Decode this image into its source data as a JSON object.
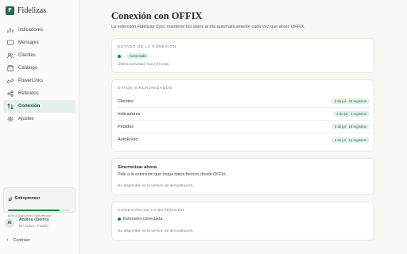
{
  "brand": {
    "name": "Fidelizas",
    "logo_letter": "F"
  },
  "nav": [
    {
      "label": "Indicadores",
      "icon": "chart-icon",
      "active": false
    },
    {
      "label": "Mensajes",
      "icon": "message-icon",
      "active": false
    },
    {
      "label": "Clientes",
      "icon": "users-icon",
      "active": false
    },
    {
      "label": "Catálogo",
      "icon": "box-icon",
      "active": false
    },
    {
      "label": "PowerLinks",
      "icon": "link-icon",
      "active": false
    },
    {
      "label": "Referidos",
      "icon": "share-icon",
      "active": false
    },
    {
      "label": "Conexión",
      "icon": "sync-icon",
      "active": true
    },
    {
      "label": "Ajustes",
      "icon": "gear-icon",
      "active": false
    }
  ],
  "plan": {
    "name": "Entrepreneur",
    "progress_fraction": 0.82,
    "note": "82% a Executive Entrepreneur"
  },
  "user": {
    "initials": "AI",
    "name": "Andrea (Demo)",
    "meta": "ID: Activo · Fusión"
  },
  "collapse_label": "Contraer",
  "header": {
    "title": "Conexión con OFFIX",
    "subtitle": "La extensión Fidelizas Sync mantiene tus datos al día automáticamente cada vez que abres OFFIX."
  },
  "status_card": {
    "label": "ESTADO DE LA CONEXIÓN",
    "badge": "Conectado",
    "last_activity": "Última actividad: hace 3 horas"
  },
  "sync_card": {
    "label": "DATOS SINCRONIZADOS",
    "rows": [
      {
        "name": "Clientes",
        "value": "2 de jul · 42 registros"
      },
      {
        "name": "Indicadores",
        "value": "2 de jul · 1 registros"
      },
      {
        "name": "Pedidos",
        "value": "2 de jul · 18 registros"
      },
      {
        "name": "AutoEnvío",
        "value": "2 de jul · 12 registros"
      }
    ]
  },
  "sync_now_card": {
    "title": "Sincronizar ahora",
    "description": "Pide a la extensión que traiga datos frescos desde OFFIX.",
    "note": "No disponible en la versión de demostración."
  },
  "extension_card": {
    "label": "CONEXIÓN DE LA EXTENSIÓN",
    "status": "Extensión conectada.",
    "note": "No disponible en la versión de demostración."
  },
  "colors": {
    "accent": "#1f7a52",
    "badge_bg": "#e2f2e8",
    "page_bg": "#f7f7f4"
  }
}
